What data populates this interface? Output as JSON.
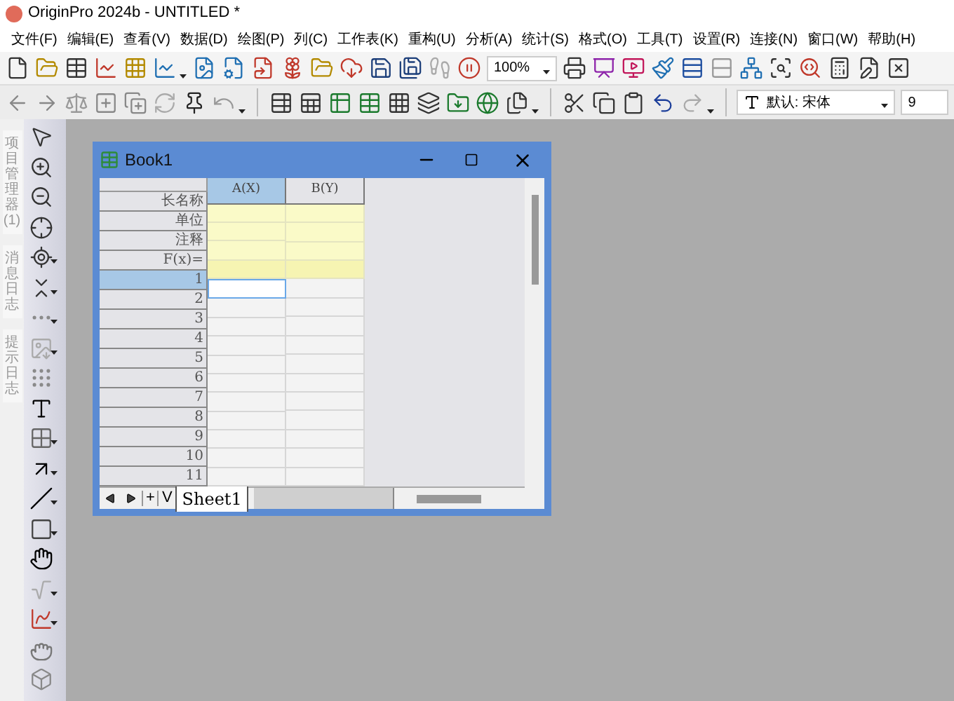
{
  "window": {
    "title": "OriginPro 2024b - UNTITLED *"
  },
  "menu": [
    "文件(F)",
    "编辑(E)",
    "查看(V)",
    "数据(D)",
    "绘图(P)",
    "列(C)",
    "工作表(K)",
    "重构(U)",
    "分析(A)",
    "统计(S)",
    "格式(O)",
    "工具(T)",
    "设置(R)",
    "连接(N)",
    "窗口(W)",
    "帮助(H)"
  ],
  "toolbar": {
    "zoom": "100%",
    "font": "默认: 宋体",
    "font_size": "9"
  },
  "side_tabs": [
    "项目管理器 (1)",
    "消息日志",
    "提示日志"
  ],
  "workbook": {
    "title": "Book1",
    "columns": [
      {
        "label": "A(X)",
        "selected": true
      },
      {
        "label": "B(Y)",
        "selected": false
      }
    ],
    "header_rows": [
      "长名称",
      "单位",
      "注释",
      "F(x)="
    ],
    "rows": [
      {
        "label": "1",
        "selected": true
      },
      {
        "label": "2",
        "selected": false
      },
      {
        "label": "3",
        "selected": false
      },
      {
        "label": "4",
        "selected": false
      },
      {
        "label": "5",
        "selected": false
      },
      {
        "label": "6",
        "selected": false
      },
      {
        "label": "7",
        "selected": false
      },
      {
        "label": "8",
        "selected": false
      },
      {
        "label": "9",
        "selected": false
      },
      {
        "label": "10",
        "selected": false
      },
      {
        "label": "11",
        "selected": false
      }
    ],
    "nav_buttons": [
      "+",
      "V"
    ],
    "sheets": [
      {
        "label": "Sheet1",
        "selected": true
      }
    ]
  }
}
